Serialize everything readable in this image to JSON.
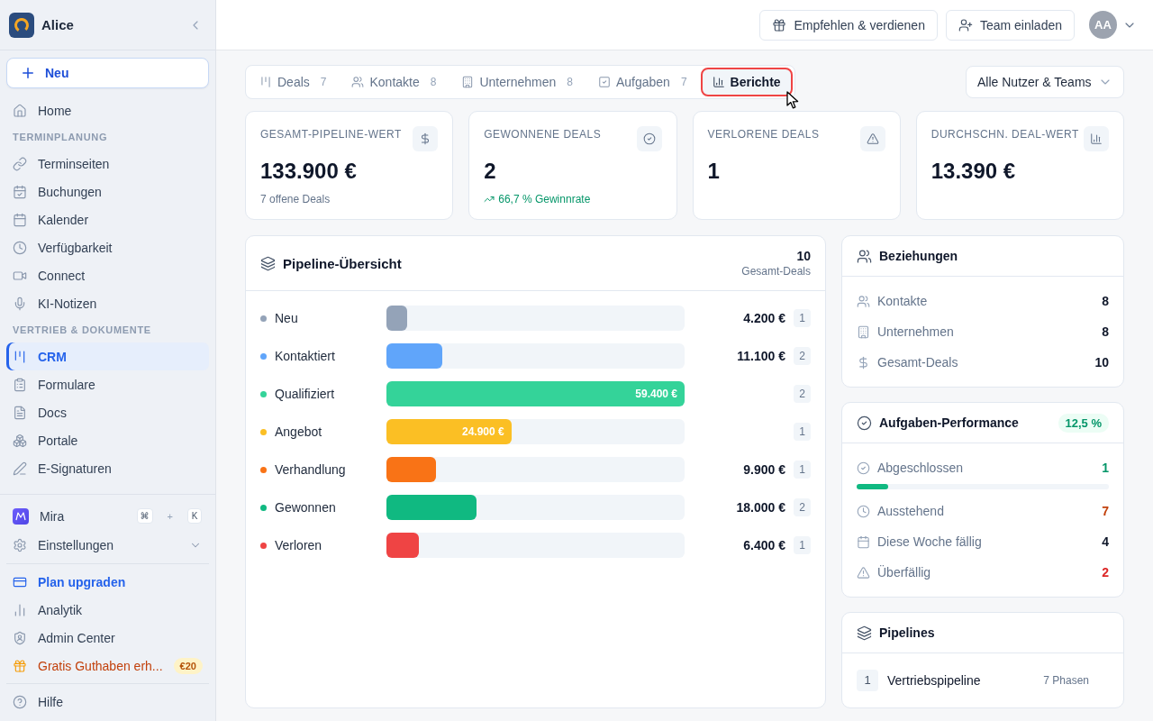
{
  "sidebar": {
    "workspace": "Alice",
    "new_button": "Neu",
    "sections": [
      {
        "items": [
          {
            "label": "Home",
            "selected": false
          }
        ]
      },
      {
        "title": "TERMINPLANUNG",
        "items": [
          {
            "label": "Terminseiten",
            "selected": false
          },
          {
            "label": "Buchungen",
            "selected": false
          },
          {
            "label": "Kalender",
            "selected": false
          },
          {
            "label": "Verfügbarkeit",
            "selected": false
          },
          {
            "label": "Connect",
            "selected": false
          },
          {
            "label": "KI-Notizen",
            "selected": false
          }
        ]
      },
      {
        "title": "VERTRIEB & DOKUMENTE",
        "items": [
          {
            "label": "CRM",
            "selected": true
          },
          {
            "label": "Formulare",
            "selected": false
          },
          {
            "label": "Docs",
            "selected": false
          },
          {
            "label": "Portale",
            "selected": false
          },
          {
            "label": "E-Signaturen",
            "selected": false
          }
        ]
      }
    ],
    "assistant": {
      "label": "Mira",
      "shortcut": {
        "keys": [
          "⌘",
          "K"
        ],
        "joiner": "+"
      }
    },
    "settings": {
      "label": "Einstellungen",
      "expanded": false
    },
    "links": [
      {
        "label": "Plan upgraden",
        "kind": "upgrade"
      },
      {
        "label": "Analytik",
        "kind": "plain"
      },
      {
        "label": "Admin Center",
        "kind": "plain"
      },
      {
        "label": "Gratis Guthaben erh...",
        "kind": "promo",
        "badge": "€20"
      }
    ],
    "help": "Hilfe"
  },
  "header": {
    "buttons": [
      {
        "label": "Empfehlen & verdienen"
      },
      {
        "label": "Team einladen"
      }
    ],
    "avatar": "AA"
  },
  "tabs": [
    {
      "label": "Deals",
      "count": "7",
      "selected": false
    },
    {
      "label": "Kontakte",
      "count": "8",
      "selected": false
    },
    {
      "label": "Unternehmen",
      "count": "8",
      "selected": false
    },
    {
      "label": "Aufgaben",
      "count": "7",
      "selected": false
    },
    {
      "label": "Berichte",
      "selected": true
    }
  ],
  "filter": {
    "value": "Alle Nutzer & Teams"
  },
  "stats": [
    {
      "label": "GESAMT-PIPELINE-WERT",
      "value": "133.900 €",
      "note": {
        "text": "7 offene Deals",
        "kind": "muted"
      }
    },
    {
      "label": "GEWONNENE DEALS",
      "value": "2",
      "note": {
        "text": "66,7 % Gewinnrate",
        "kind": "trend"
      }
    },
    {
      "label": "VERLORENE DEALS",
      "value": "1"
    },
    {
      "label": "DURCHSCHN. DEAL-WERT",
      "value": "13.390 €"
    }
  ],
  "pipeline": {
    "title": "Pipeline-Übersicht",
    "total": "10",
    "total_label": "Gesamt-Deals",
    "stages": [
      {
        "name": "Neu",
        "color": "#94a3b8",
        "level": 0.07,
        "value": "4.200 €",
        "value_inside": false,
        "count": "1"
      },
      {
        "name": "Kontaktiert",
        "color": "#60a5fa",
        "level": 0.187,
        "value": "11.100 €",
        "value_inside": false,
        "count": "2"
      },
      {
        "name": "Qualifiziert",
        "color": "#34d399",
        "level": 1,
        "value": "59.400 €",
        "value_inside": true,
        "count": "2"
      },
      {
        "name": "Angebot",
        "color": "#fbbf24",
        "level": 0.419,
        "value": "24.900 €",
        "value_inside": true,
        "count": "1"
      },
      {
        "name": "Verhandlung",
        "color": "#f97316",
        "level": 0.167,
        "value": "9.900 €",
        "value_inside": false,
        "count": "1"
      },
      {
        "name": "Gewonnen",
        "color": "#10b981",
        "level": 0.303,
        "value": "18.000 €",
        "value_inside": false,
        "count": "2"
      },
      {
        "name": "Verloren",
        "color": "#ef4444",
        "level": 0.108,
        "value": "6.400 €",
        "value_inside": false,
        "count": "1"
      }
    ]
  },
  "relations": {
    "title": "Beziehungen",
    "rows": [
      {
        "label": "Kontakte",
        "value": "8"
      },
      {
        "label": "Unternehmen",
        "value": "8"
      },
      {
        "label": "Gesamt-Deals",
        "value": "10"
      }
    ]
  },
  "tasks": {
    "title": "Aufgaben-Performance",
    "rate": "12,5 %",
    "rows": [
      {
        "label": "Abgeschlossen",
        "value": "1",
        "color": "#059669",
        "kind": "progress",
        "level": 0.125
      },
      {
        "label": "Ausstehend",
        "value": "7",
        "color": "#c2410c",
        "kind": "plain"
      },
      {
        "label": "Diese Woche fällig",
        "value": "4",
        "color": "#0f172a",
        "kind": "plain"
      },
      {
        "label": "Überfällig",
        "value": "2",
        "color": "#dc2626",
        "kind": "plain"
      }
    ]
  },
  "pipelines": {
    "title": "Pipelines",
    "items": [
      {
        "index": "1",
        "name": "Vertriebspipeline",
        "phases": "7 Phasen"
      }
    ]
  }
}
